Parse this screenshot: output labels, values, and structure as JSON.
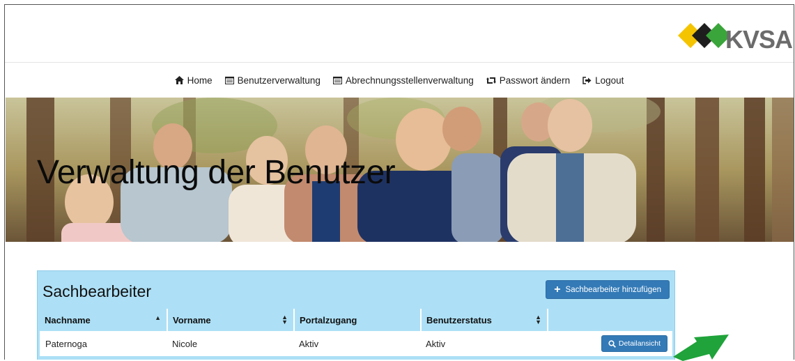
{
  "logo": {
    "text": "KVSA",
    "colors": [
      "#f5c400",
      "#1e1e1e",
      "#3aa53a"
    ]
  },
  "nav": {
    "items": [
      {
        "label": "Home",
        "icon": "home-icon"
      },
      {
        "label": "Benutzerverwaltung",
        "icon": "list-icon"
      },
      {
        "label": "Abrechnungsstellenverwaltung",
        "icon": "list-icon"
      },
      {
        "label": "Passwort ändern",
        "icon": "retweet-icon"
      },
      {
        "label": "Logout",
        "icon": "logout-icon"
      }
    ]
  },
  "hero": {
    "title": "Verwaltung der Benutzer"
  },
  "panel": {
    "title": "Sachbearbeiter",
    "add_button": "Sachbearbeiter hinzufügen",
    "columns": [
      {
        "label": "Nachname",
        "sort": "asc"
      },
      {
        "label": "Vorname",
        "sort": "both"
      },
      {
        "label": "Portalzugang",
        "sort": "none"
      },
      {
        "label": "Benutzerstatus",
        "sort": "both"
      },
      {
        "label": "",
        "sort": "none"
      }
    ],
    "rows": [
      {
        "nachname": "Paternoga",
        "vorname": "Nicole",
        "portalzugang": "Aktiv",
        "benutzerstatus": "Aktiv",
        "action": "Detailansicht"
      }
    ]
  },
  "colors": {
    "panel_bg": "#ade0f6",
    "button": "#337ab7",
    "arrow": "#1fa33a"
  }
}
